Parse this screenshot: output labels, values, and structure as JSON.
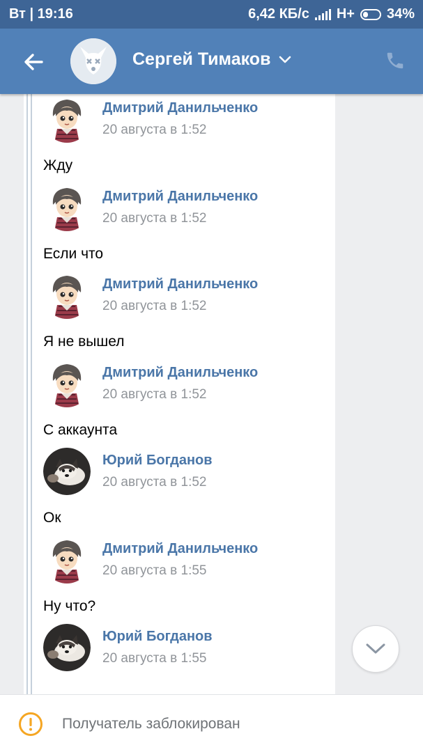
{
  "status_bar": {
    "day_time": "Вт | 19:16",
    "speed": "6,42 КБ/с",
    "network": "H+",
    "battery": "34%",
    "battery_level": 0.34
  },
  "header": {
    "title": "Сергей Тимаков"
  },
  "messages": [
    {
      "name": "Дмитрий Данильченко",
      "date": "20 августа в 1:52",
      "text": "Жду",
      "avatar": "anime"
    },
    {
      "name": "Дмитрий Данильченко",
      "date": "20 августа в 1:52",
      "text": "Если что",
      "avatar": "anime"
    },
    {
      "name": "Дмитрий Данильченко",
      "date": "20 августа в 1:52",
      "text": "Я не вышел",
      "avatar": "anime"
    },
    {
      "name": "Дмитрий Данильченко",
      "date": "20 августа в 1:52",
      "text": "С аккаунта",
      "avatar": "anime"
    },
    {
      "name": "Юрий Богданов",
      "date": "20 августа в 1:52",
      "text": "Ок",
      "avatar": "dog"
    },
    {
      "name": "Дмитрий Данильченко",
      "date": "20 августа в 1:55",
      "text": "Ну что?",
      "avatar": "anime"
    },
    {
      "name": "Юрий Богданов",
      "date": "20 августа в 1:55",
      "text": "",
      "avatar": "dog"
    }
  ],
  "bottom": {
    "blocked_text": "Получатель заблокирован"
  },
  "colors": {
    "header": "#5181b8",
    "status_bar": "#3e6596",
    "link": "#4a76a8",
    "warning": "#f5a623"
  },
  "icons": [
    "back-arrow-icon",
    "deleted-user-icon",
    "chevron-down-icon",
    "phone-icon",
    "warning-icon"
  ]
}
